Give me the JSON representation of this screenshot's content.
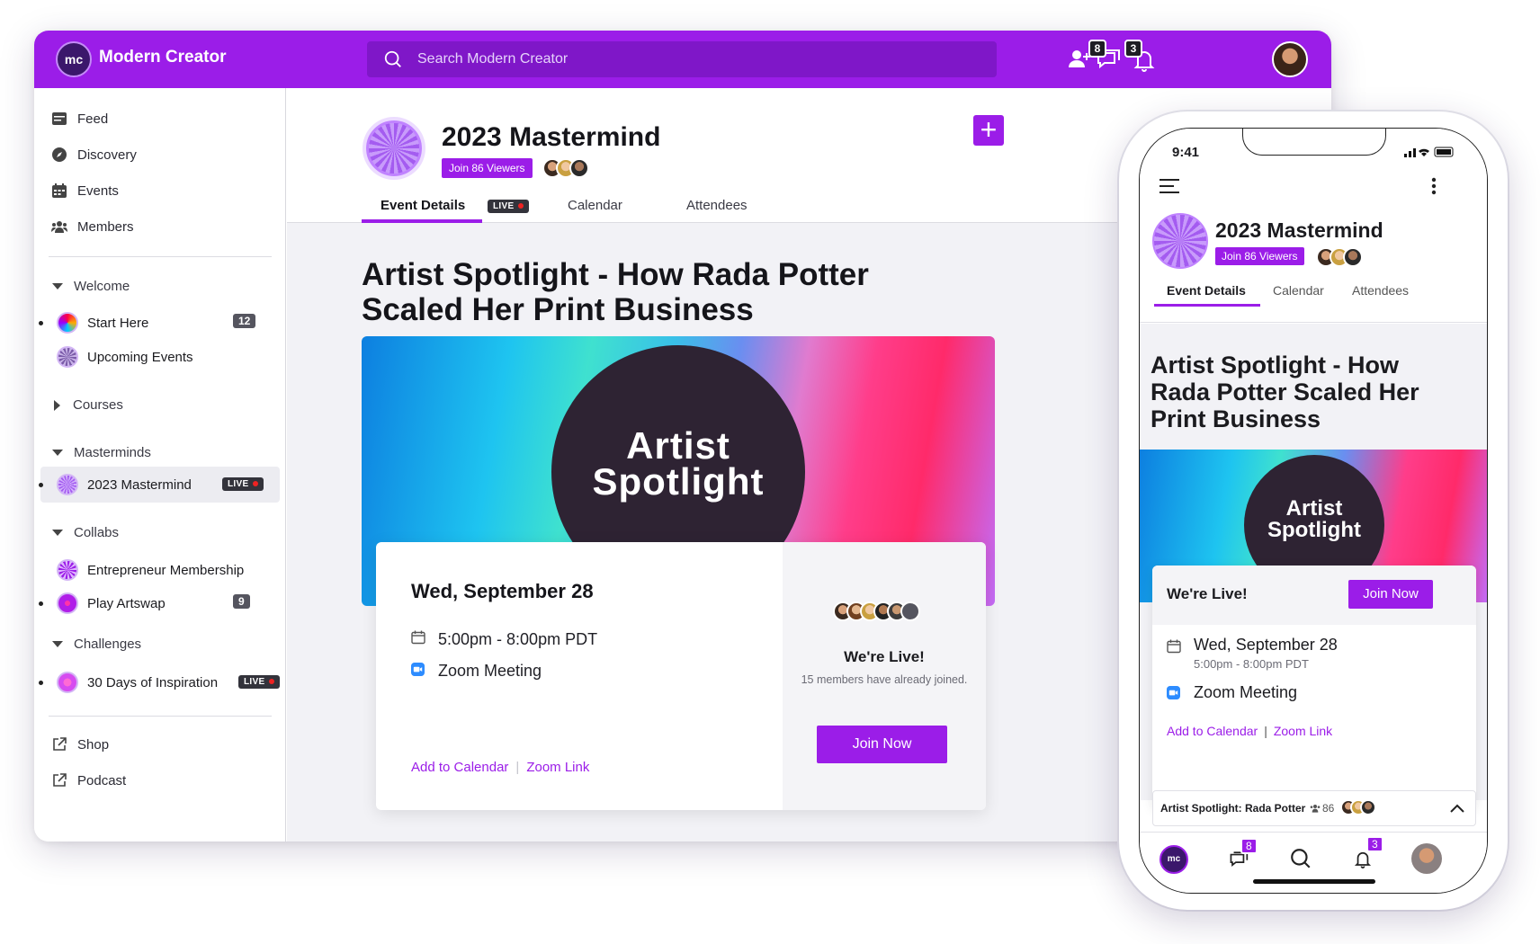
{
  "app": {
    "name": "Modern Creator",
    "logo": "mc"
  },
  "search": {
    "placeholder": "Search Modern Creator"
  },
  "topbar": {
    "messages_count": "8",
    "notifications_count": "3"
  },
  "sidebar": {
    "nav": [
      {
        "label": "Feed",
        "icon": "feed-icon"
      },
      {
        "label": "Discovery",
        "icon": "compass-icon"
      },
      {
        "label": "Events",
        "icon": "calendar-icon"
      },
      {
        "label": "Members",
        "icon": "members-icon"
      }
    ],
    "groups": [
      {
        "label": "Welcome",
        "items": [
          {
            "label": "Start Here",
            "count": "12"
          },
          {
            "label": "Upcoming Events"
          }
        ]
      },
      {
        "label": "Courses",
        "items": []
      },
      {
        "label": "Masterminds",
        "items": [
          {
            "label": "2023 Mastermind",
            "badge": "LIVE"
          }
        ]
      },
      {
        "label": "Collabs",
        "items": [
          {
            "label": "Entrepreneur Membership"
          },
          {
            "label": "Play Artswap",
            "count": "9"
          }
        ]
      },
      {
        "label": "Challenges",
        "items": [
          {
            "label": "30 Days of Inspiration",
            "badge": "LIVE"
          }
        ]
      }
    ],
    "links": [
      {
        "label": "Shop"
      },
      {
        "label": "Podcast"
      }
    ]
  },
  "event": {
    "space_title": "2023 Mastermind",
    "join_viewers": "Join 86 Viewers",
    "tabs": [
      {
        "label": "Event Details",
        "badge": "LIVE"
      },
      {
        "label": "Calendar"
      },
      {
        "label": "Attendees"
      }
    ],
    "title": "Artist Spotlight - How Rada Potter Scaled Her Print Business",
    "banner_text_1": "Artist",
    "banner_text_2": "Spotlight",
    "date": "Wed, September 28",
    "time": "5:00pm - 8:00pm PDT",
    "location": "Zoom Meeting",
    "add_to_calendar": "Add to Calendar",
    "zoom_link": "Zoom Link",
    "live_heading": "We're Live!",
    "joined_text": "15 members have already joined.",
    "join_now": "Join Now"
  },
  "phone": {
    "time": "9:41",
    "title": "Artist Spotlight - How Rada Potter Scaled Her Print Business",
    "mini_player": "Artist Spotlight: Rada Potter",
    "mini_count": "86",
    "messages_count": "8",
    "notifications_count": "3"
  },
  "colors": {
    "brand": "#9b1de8",
    "brand_dark": "#7f17c8",
    "live": "#e22222"
  }
}
